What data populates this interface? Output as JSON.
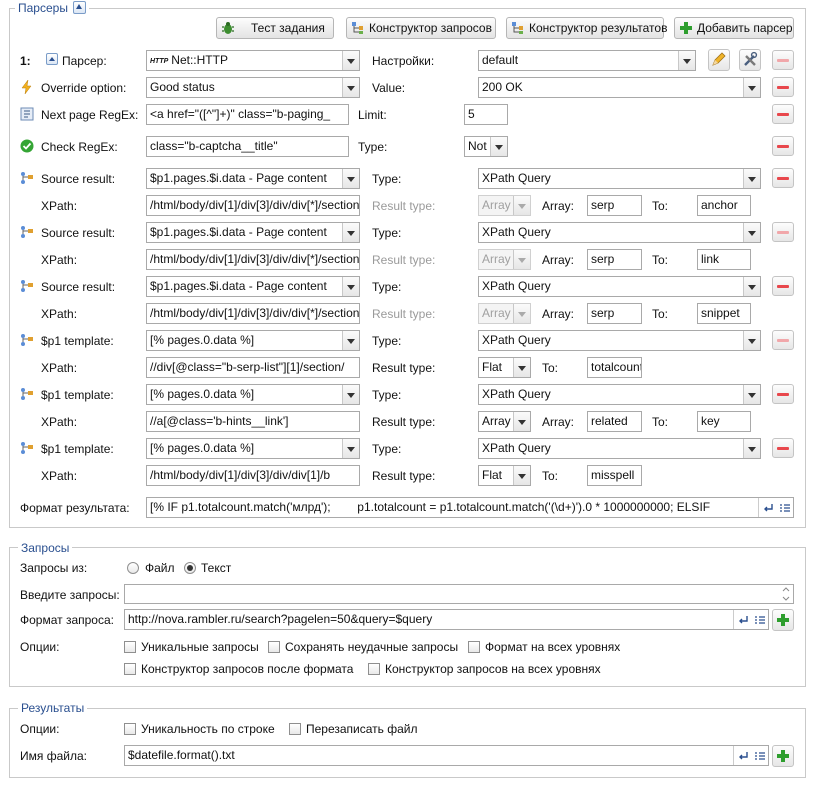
{
  "parsers": {
    "legend": "Парсеры",
    "toolbar": {
      "test_task": "Тест задания",
      "query_builder": "Конструктор запросов",
      "result_builder": "Конструктор результатов",
      "add_parser": "Добавить парсер"
    },
    "row_index": "1:",
    "parser_label": "Парсер:",
    "parser_value": "Net::HTTP",
    "parser_icon_text": "HTTP",
    "settings_label": "Настройки:",
    "settings_value": "default",
    "override_label": "Override option:",
    "override_value": "Good status",
    "value_label": "Value:",
    "value_value": "200 OK",
    "next_page_label": "Next page RegEx:",
    "next_page_value": "<a href=\"([^\"]+)\" class=\"b-paging_",
    "limit_label": "Limit:",
    "limit_value": "5",
    "check_label": "Check RegEx:",
    "check_value": "class=\"b-captcha__title\"",
    "type_label": "Type:",
    "check_type_value": "Not",
    "xpath_label": "XPath:",
    "result_type_label": "Result type:",
    "array_label": "Array:",
    "to_label": "To:",
    "results": [
      {
        "label": "Source result:",
        "source": "$p1.pages.$i.data - Page content",
        "type": "XPath Query",
        "xpath": "/html/body/div[1]/div[3]/div/div[*]/section",
        "result_type": "Array",
        "rt_disabled": true,
        "has_array": true,
        "array": "serp",
        "to": "anchor",
        "minus_faded": false
      },
      {
        "label": "Source result:",
        "source": "$p1.pages.$i.data - Page content",
        "type": "XPath Query",
        "xpath": "/html/body/div[1]/div[3]/div/div[*]/section",
        "result_type": "Array",
        "rt_disabled": true,
        "has_array": true,
        "array": "serp",
        "to": "link",
        "minus_faded": true
      },
      {
        "label": "Source result:",
        "source": "$p1.pages.$i.data - Page content",
        "type": "XPath Query",
        "xpath": "/html/body/div[1]/div[3]/div/div[*]/section",
        "result_type": "Array",
        "rt_disabled": true,
        "has_array": true,
        "array": "serp",
        "to": "snippet",
        "minus_faded": false
      },
      {
        "label": "$p1 template:",
        "source": "[% pages.0.data %]",
        "type": "XPath Query",
        "xpath": "//div[@class=\"b-serp-list\"][1]/section/",
        "result_type": "Flat",
        "rt_disabled": false,
        "has_array": false,
        "array": "",
        "to": "totalcount",
        "minus_faded": true
      },
      {
        "label": "$p1 template:",
        "source": "[% pages.0.data %]",
        "type": "XPath Query",
        "xpath": "//a[@class='b-hints__link']",
        "result_type": "Array",
        "rt_disabled": false,
        "has_array": true,
        "array": "related",
        "to": "key",
        "minus_faded": false
      },
      {
        "label": "$p1 template:",
        "source": "[% pages.0.data %]",
        "type": "XPath Query",
        "xpath": "/html/body/div[1]/div[3]/div/div[1]/b",
        "result_type": "Flat",
        "rt_disabled": false,
        "has_array": false,
        "array": "",
        "to": "misspell",
        "minus_faded": false
      }
    ],
    "format_label": "Формат результата:",
    "format_value": "[% IF p1.totalcount.match('млрд');        p1.totalcount = p1.totalcount.match('(\\d+)').0 * 1000000000; ELSIF"
  },
  "queries": {
    "legend": "Запросы",
    "from_label": "Запросы из:",
    "file_option": "Файл",
    "text_option": "Текст",
    "selected": "Текст",
    "enter_label": "Введите запросы:",
    "enter_value": "",
    "format_label": "Формат запроса:",
    "format_value": "http://nova.rambler.ru/search?pagelen=50&query=$query",
    "options_label": "Опции:",
    "options": [
      {
        "label": "Уникальные запросы",
        "checked": false
      },
      {
        "label": "Сохранять неудачные запросы",
        "checked": false
      },
      {
        "label": "Формат на всех уровнях",
        "checked": false
      },
      {
        "label": "Конструктор запросов после формата",
        "checked": false
      },
      {
        "label": "Конструктор запросов на всех уровнях",
        "checked": false
      }
    ]
  },
  "results_section": {
    "legend": "Результаты",
    "options_label": "Опции:",
    "options": [
      {
        "label": "Уникальность по строке",
        "checked": false
      },
      {
        "label": "Перезаписать файл",
        "checked": false
      }
    ],
    "filename_label": "Имя файла:",
    "filename_value": "$datefile.format().txt"
  },
  "colors": {
    "accent": "#2a4f8f",
    "remove": "#e8474c",
    "add": "#2e9e2e",
    "border": "#c9c9c9"
  }
}
